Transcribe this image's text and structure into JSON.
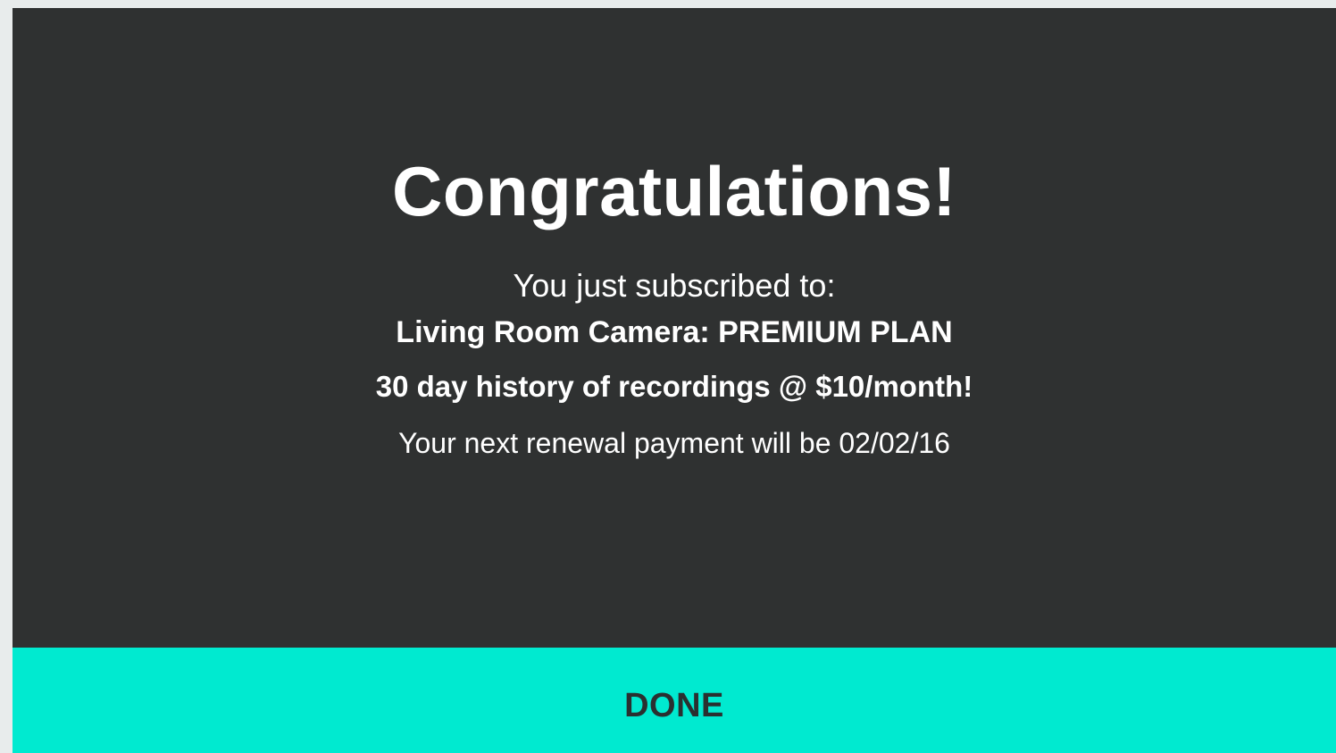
{
  "dialog": {
    "title": "Congratulations!",
    "subtitle": "You just subscribed to:",
    "plan": "Living Room Camera: PREMIUM PLAN",
    "history": "30 day history of recordings @ $10/month!",
    "renewal": "Your next renewal payment will be 02/02/16",
    "done_label": "DONE"
  },
  "colors": {
    "background": "#2f3131",
    "accent": "#00ead0",
    "text": "#ffffff"
  }
}
